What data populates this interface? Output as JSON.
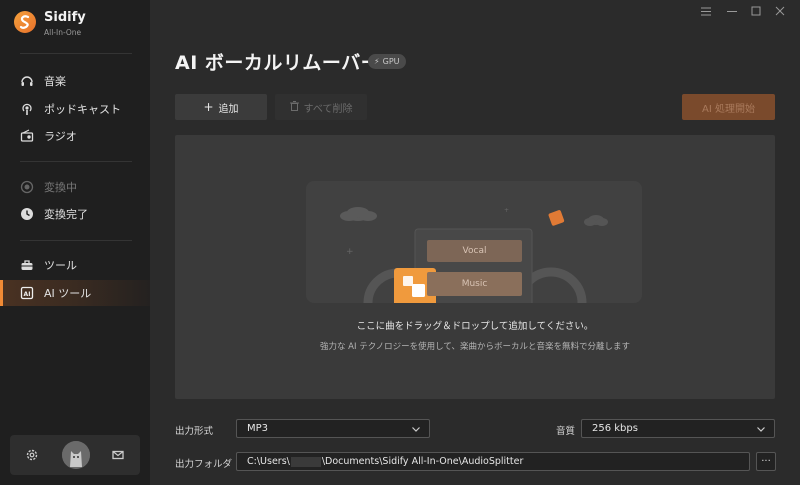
{
  "app": {
    "name": "Sidify",
    "subtitle": "All-In-One"
  },
  "sidebar": {
    "items": [
      {
        "label": "音楽",
        "icon": "music-icon"
      },
      {
        "label": "ポッドキャスト",
        "icon": "podcast-icon"
      },
      {
        "label": "ラジオ",
        "icon": "radio-icon"
      },
      {
        "label": "変換中",
        "icon": "converting-icon"
      },
      {
        "label": "変換完了",
        "icon": "clock-icon"
      },
      {
        "label": "ツール",
        "icon": "toolbox-icon"
      },
      {
        "label": "AI ツール",
        "icon": "ai-icon"
      }
    ],
    "active_item": "AI ツール"
  },
  "window_controls": [
    "menu-icon",
    "minimize-icon",
    "maximize-icon",
    "close-icon"
  ],
  "page": {
    "title": "AI ボーカルリムーバー",
    "badge": "GPU"
  },
  "toolbar": {
    "add_label": "追加",
    "clear_label": "すべて削除",
    "start_label": "AI 処理開始"
  },
  "dropzone": {
    "vocal_label": "Vocal",
    "music_label": "Music",
    "main_text": "ここに曲をドラッグ＆ドロップして追加してください。",
    "sub_text": "強力な AI テクノロジーを使用して、楽曲からボーカルと音楽を無料で分離します"
  },
  "settings": {
    "format_label": "出力形式",
    "format_value": "MP3",
    "quality_label": "音質",
    "quality_value": "256 kbps",
    "folder_label": "出力フォルダ",
    "folder_prefix": "C:\\Users\\",
    "folder_suffix": "\\Documents\\Sidify All-In-One\\AudioSplitter",
    "more_label": "···"
  },
  "colors": {
    "accent": "#f08a35",
    "sidebar_bg": "#1f1f1f",
    "main_bg": "#2b2b2b",
    "start_button": "#7a4a2c"
  }
}
